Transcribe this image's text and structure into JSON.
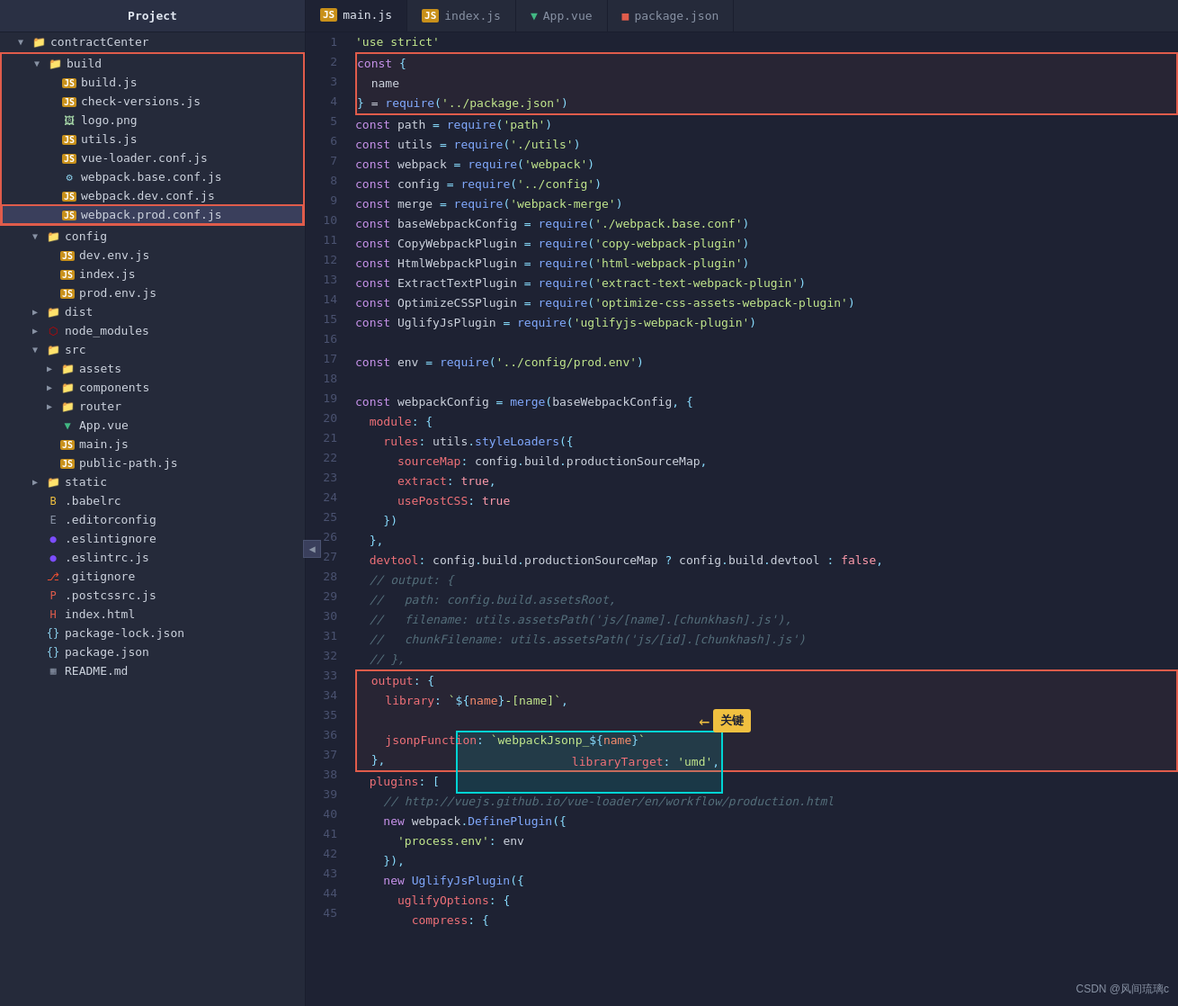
{
  "header": {
    "tabs": [
      {
        "id": "main-js",
        "label": "main.js",
        "icon": "js",
        "active": false
      },
      {
        "id": "index-js",
        "label": "index.js",
        "icon": "js",
        "active": false
      },
      {
        "id": "app-vue",
        "label": "App.vue",
        "icon": "vue",
        "active": false
      },
      {
        "id": "package-json",
        "label": "package.json",
        "icon": "pkg",
        "active": false
      }
    ]
  },
  "sidebar": {
    "title": "Project",
    "tree": [
      {
        "id": "contractCenter",
        "label": "contractCenter",
        "type": "folder",
        "depth": 0,
        "open": true
      },
      {
        "id": "build",
        "label": "build",
        "type": "folder",
        "depth": 1,
        "open": true
      },
      {
        "id": "build-js",
        "label": "build.js",
        "type": "js",
        "depth": 2
      },
      {
        "id": "check-versions",
        "label": "check-versions.js",
        "type": "js",
        "depth": 2
      },
      {
        "id": "logo-png",
        "label": "logo.png",
        "type": "png",
        "depth": 2
      },
      {
        "id": "utils-js",
        "label": "utils.js",
        "type": "js",
        "depth": 2
      },
      {
        "id": "vue-loader",
        "label": "vue-loader.conf.js",
        "type": "js",
        "depth": 2
      },
      {
        "id": "webpack-base",
        "label": "webpack.base.conf.js",
        "type": "webpack",
        "depth": 2
      },
      {
        "id": "webpack-dev",
        "label": "webpack.dev.conf.js",
        "type": "js",
        "depth": 2
      },
      {
        "id": "webpack-prod",
        "label": "webpack.prod.conf.js",
        "type": "js",
        "depth": 2,
        "selected": true,
        "highlighted": true
      },
      {
        "id": "config",
        "label": "config",
        "type": "folder",
        "depth": 1,
        "open": true
      },
      {
        "id": "dev-env",
        "label": "dev.env.js",
        "type": "js",
        "depth": 2
      },
      {
        "id": "config-index",
        "label": "index.js",
        "type": "js",
        "depth": 2
      },
      {
        "id": "prod-env",
        "label": "prod.env.js",
        "type": "js",
        "depth": 2
      },
      {
        "id": "dist",
        "label": "dist",
        "type": "folder",
        "depth": 1,
        "open": false
      },
      {
        "id": "node-modules",
        "label": "node_modules",
        "type": "folder-npm",
        "depth": 1,
        "open": false
      },
      {
        "id": "src",
        "label": "src",
        "type": "folder",
        "depth": 1,
        "open": true
      },
      {
        "id": "assets",
        "label": "assets",
        "type": "folder",
        "depth": 2,
        "open": false
      },
      {
        "id": "components",
        "label": "components",
        "type": "folder",
        "depth": 2,
        "open": false
      },
      {
        "id": "router",
        "label": "router",
        "type": "folder",
        "depth": 2,
        "open": false
      },
      {
        "id": "app-vue-file",
        "label": "App.vue",
        "type": "vue",
        "depth": 2
      },
      {
        "id": "main-js-file",
        "label": "main.js",
        "type": "js",
        "depth": 2
      },
      {
        "id": "public-path",
        "label": "public-path.js",
        "type": "js",
        "depth": 2
      },
      {
        "id": "static",
        "label": "static",
        "type": "folder",
        "depth": 1,
        "open": false
      },
      {
        "id": "babelrc",
        "label": ".babelrc",
        "type": "babel",
        "depth": 1
      },
      {
        "id": "editorconfig",
        "label": ".editorconfig",
        "type": "editor",
        "depth": 1
      },
      {
        "id": "eslintignore",
        "label": ".eslintignore",
        "type": "eslint",
        "depth": 1
      },
      {
        "id": "eslintrc",
        "label": ".eslintrc.js",
        "type": "eslint",
        "depth": 1
      },
      {
        "id": "gitignore",
        "label": ".gitignore",
        "type": "git",
        "depth": 1
      },
      {
        "id": "postcssrc",
        "label": ".postcssrc.js",
        "type": "postcss",
        "depth": 1
      },
      {
        "id": "index-html",
        "label": "index.html",
        "type": "html",
        "depth": 1
      },
      {
        "id": "package-lock",
        "label": "package-lock.json",
        "type": "json",
        "depth": 1
      },
      {
        "id": "package-json-file",
        "label": "package.json",
        "type": "json",
        "depth": 1
      },
      {
        "id": "readme",
        "label": "README.md",
        "type": "md",
        "depth": 1
      }
    ]
  },
  "code": {
    "filename": "webpack.prod.conf.js",
    "lines": [
      {
        "n": 1,
        "text": "'use strict'"
      },
      {
        "n": 2,
        "text": "const {"
      },
      {
        "n": 3,
        "text": "  name"
      },
      {
        "n": 4,
        "text": "} = require('../package.json')"
      },
      {
        "n": 5,
        "text": "const path = require('path')"
      },
      {
        "n": 6,
        "text": "const utils = require('./utils')"
      },
      {
        "n": 7,
        "text": "const webpack = require('webpack')"
      },
      {
        "n": 8,
        "text": "const config = require('../config')"
      },
      {
        "n": 9,
        "text": "const merge = require('webpack-merge')"
      },
      {
        "n": 10,
        "text": "const baseWebpackConfig = require('./webpack.base.conf')"
      },
      {
        "n": 11,
        "text": "const CopyWebpackPlugin = require('copy-webpack-plugin')"
      },
      {
        "n": 12,
        "text": "const HtmlWebpackPlugin = require('html-webpack-plugin')"
      },
      {
        "n": 13,
        "text": "const ExtractTextPlugin = require('extract-text-webpack-plugin')"
      },
      {
        "n": 14,
        "text": "const OptimizeCSSPlugin = require('optimize-css-assets-webpack-plugin')"
      },
      {
        "n": 15,
        "text": "const UglifyJsPlugin = require('uglifyjs-webpack-plugin')"
      },
      {
        "n": 16,
        "text": ""
      },
      {
        "n": 17,
        "text": "const env = require('../config/prod.env')"
      },
      {
        "n": 18,
        "text": ""
      },
      {
        "n": 19,
        "text": "const webpackConfig = merge(baseWebpackConfig, {"
      },
      {
        "n": 20,
        "text": "  module: {"
      },
      {
        "n": 21,
        "text": "    rules: utils.styleLoaders({"
      },
      {
        "n": 22,
        "text": "      sourceMap: config.build.productionSourceMap,"
      },
      {
        "n": 23,
        "text": "      extract: true,"
      },
      {
        "n": 24,
        "text": "      usePostCSS: true"
      },
      {
        "n": 25,
        "text": "    })"
      },
      {
        "n": 26,
        "text": "  },"
      },
      {
        "n": 27,
        "text": "  devtool: config.build.productionSourceMap ? config.build.devtool : false,"
      },
      {
        "n": 28,
        "text": "  // output: {"
      },
      {
        "n": 29,
        "text": "  //   path: config.build.assetsRoot,"
      },
      {
        "n": 30,
        "text": "  //   filename: utils.assetsPath('js/[name].[chunkhash].js'),"
      },
      {
        "n": 31,
        "text": "  //   chunkFilename: utils.assetsPath('js/[id].[chunkhash].js')"
      },
      {
        "n": 32,
        "text": "  // },"
      },
      {
        "n": 33,
        "text": "  output: {"
      },
      {
        "n": 34,
        "text": "    library: `${name}-[name]`,"
      },
      {
        "n": 35,
        "text": "    libraryTarget: 'umd',"
      },
      {
        "n": 36,
        "text": "    jsonpFunction: `webpackJsonp_${name}`"
      },
      {
        "n": 37,
        "text": "  },"
      },
      {
        "n": 38,
        "text": "  plugins: ["
      },
      {
        "n": 39,
        "text": "    // http://vuejs.github.io/vue-loader/en/workflow/production.html"
      },
      {
        "n": 40,
        "text": "    new webpack.DefinePlugin({"
      },
      {
        "n": 41,
        "text": "      'process.env': env"
      },
      {
        "n": 42,
        "text": "    }),"
      },
      {
        "n": 43,
        "text": "    new UglifyJsPlugin({"
      },
      {
        "n": 44,
        "text": "      uglifyOptions: {"
      },
      {
        "n": 45,
        "text": "        compress: {"
      }
    ]
  },
  "annotation": {
    "label": "关键",
    "arrow": "←"
  },
  "watermark": "CSDN @风间琉璃c"
}
